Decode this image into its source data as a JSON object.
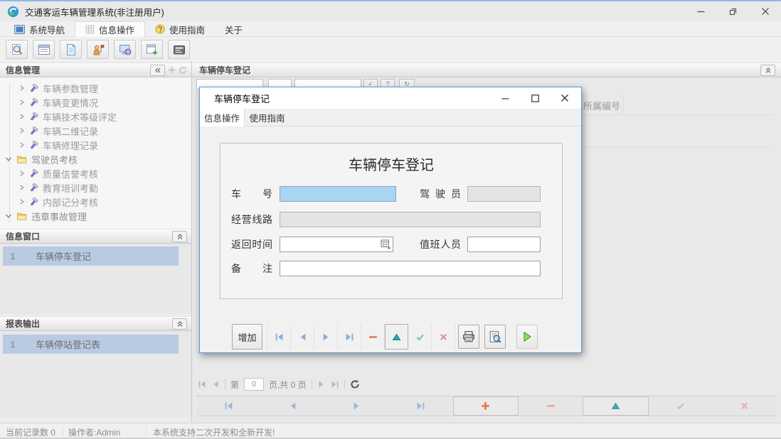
{
  "colors": {
    "accent": "#569de5",
    "highlight_row": "#b9cbe3",
    "focused_input": "#a9d5f5",
    "nav_arrow": "#7fa8d6",
    "delete_minus": "#e2805f",
    "collapse_triangle": "#2aa3ad",
    "confirm_check": "#85c287",
    "cancel_x": "#e09090",
    "run_play": "#8ddc5c"
  },
  "window": {
    "title": "交通客运车辆管理系统(非注册用户)",
    "controls": [
      "minimize",
      "restore",
      "close"
    ]
  },
  "menu": {
    "items": [
      {
        "label": "系统导航",
        "icon": "system-nav-icon",
        "active": false
      },
      {
        "label": "信息操作",
        "icon": "info-ops-icon",
        "active": true
      },
      {
        "label": "使用指南",
        "icon": "guide-icon",
        "active": false
      },
      {
        "label": "关于",
        "icon": "",
        "active": false
      }
    ]
  },
  "main_toolbar": {
    "icons": [
      "search-icon",
      "form-view-icon",
      "document-icon",
      "operator-icon",
      "display-icon",
      "new-window-icon",
      "console-icon"
    ]
  },
  "sidebar": {
    "info_panel_title": "信息管理",
    "info_panel_icons": [
      "collapse-left-icon",
      "plus-icon",
      "refresh-icon"
    ],
    "tree": [
      {
        "label": "车辆参数管理",
        "type": "leaf"
      },
      {
        "label": "车辆变更情况",
        "type": "leaf"
      },
      {
        "label": "车辆技术等级评定",
        "type": "leaf"
      },
      {
        "label": "车辆二维记录",
        "type": "leaf"
      },
      {
        "label": "车辆修理记录",
        "type": "leaf"
      },
      {
        "label": "驾驶员考核",
        "type": "folder"
      },
      {
        "label": "质量信誉考核",
        "type": "leaf"
      },
      {
        "label": "教育培训考勤",
        "type": "leaf"
      },
      {
        "label": "内部记分考核",
        "type": "leaf"
      },
      {
        "label": "违章事故管理",
        "type": "folder"
      }
    ],
    "windows_panel": {
      "title": "信息窗口",
      "items": [
        {
          "index": "1",
          "label": "车辆停车登记"
        }
      ]
    },
    "reports_panel": {
      "title": "报表输出",
      "items": [
        {
          "index": "1",
          "label": "车辆停站登记表"
        }
      ]
    }
  },
  "main_panel": {
    "title": "车辆停车登记",
    "grid_column_header": "所属编号",
    "pagination": {
      "prefix": "第",
      "page": "0",
      "suffix": "页,共 0 页",
      "icons": [
        "first",
        "previous",
        "next",
        "last",
        "refresh"
      ]
    }
  },
  "record_toolbar": {
    "icons": [
      "first",
      "previous",
      "next",
      "last",
      "add",
      "delete",
      "collapse",
      "confirm",
      "cancel"
    ]
  },
  "dialog": {
    "title": "车辆停车登记",
    "controls": [
      "minimize",
      "maximize",
      "close"
    ],
    "tabs": [
      {
        "label": "信息操作",
        "active": true
      },
      {
        "label": "使用指南",
        "active": false
      }
    ],
    "form": {
      "heading": "车辆停车登记",
      "labels": {
        "plate": "车号",
        "driver": "驾驶员",
        "route": "经营线路",
        "return_time": "返回时间",
        "duty": "值班人员",
        "remark": "备注"
      },
      "values": {
        "plate": "",
        "driver": "",
        "route": "",
        "return_time": "",
        "duty": "",
        "remark": ""
      }
    },
    "toolbar": {
      "add": "增加",
      "icons": [
        "first",
        "previous",
        "next",
        "last",
        "delete",
        "collapse",
        "confirm",
        "cancel",
        "print",
        "print-preview",
        "run"
      ]
    }
  },
  "statusbar": {
    "records": "当前记录数 0",
    "operator": "操作者:Admin",
    "message": "本系统支持二次开发和全新开发!"
  }
}
